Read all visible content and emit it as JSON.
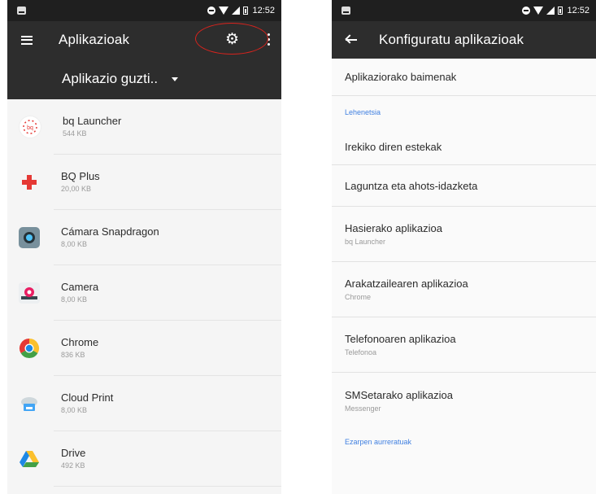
{
  "left": {
    "status": {
      "time": "12:52"
    },
    "title": "Aplikazioak",
    "filter": {
      "selected": "Aplikazio guzti.."
    },
    "apps": [
      {
        "name": "bq Launcher",
        "size": "544 KB",
        "icon": "bq-launcher-icon"
      },
      {
        "name": "BQ Plus",
        "size": "20,00 KB",
        "icon": "bq-plus-icon"
      },
      {
        "name": "Cámara Snapdragon",
        "size": "8,00 KB",
        "icon": "camera-snapdragon-icon"
      },
      {
        "name": "Camera",
        "size": "8,00 KB",
        "icon": "camera-icon"
      },
      {
        "name": "Chrome",
        "size": "836 KB",
        "icon": "chrome-icon"
      },
      {
        "name": "Cloud Print",
        "size": "8,00 KB",
        "icon": "cloud-print-icon"
      },
      {
        "name": "Drive",
        "size": "492 KB",
        "icon": "drive-icon"
      }
    ]
  },
  "right": {
    "status": {
      "time": "12:52"
    },
    "title": "Konfiguratu aplikazioak",
    "items": [
      {
        "type": "item",
        "title": "Aplikaziorako baimenak"
      },
      {
        "type": "header",
        "title": "Lehenetsia"
      },
      {
        "type": "item",
        "title": "Irekiko diren estekak"
      },
      {
        "type": "item",
        "title": "Laguntza eta ahots-idazketa"
      },
      {
        "type": "item",
        "title": "Hasierako aplikazioa",
        "subtitle": "bq Launcher"
      },
      {
        "type": "item",
        "title": "Arakatzailearen aplikazioa",
        "subtitle": "Chrome"
      },
      {
        "type": "item",
        "title": "Telefonoaren aplikazioa",
        "subtitle": "Telefonoa"
      },
      {
        "type": "item",
        "title": "SMSetarako aplikazioa",
        "subtitle": "Messenger"
      },
      {
        "type": "header",
        "title": "Ezarpen aurreratuak"
      }
    ]
  },
  "colors": {
    "appbar": "#2d2d2d",
    "statusbar": "#1f1f1f",
    "accent": "#3f7fe0",
    "highlight": "#d9231d"
  }
}
